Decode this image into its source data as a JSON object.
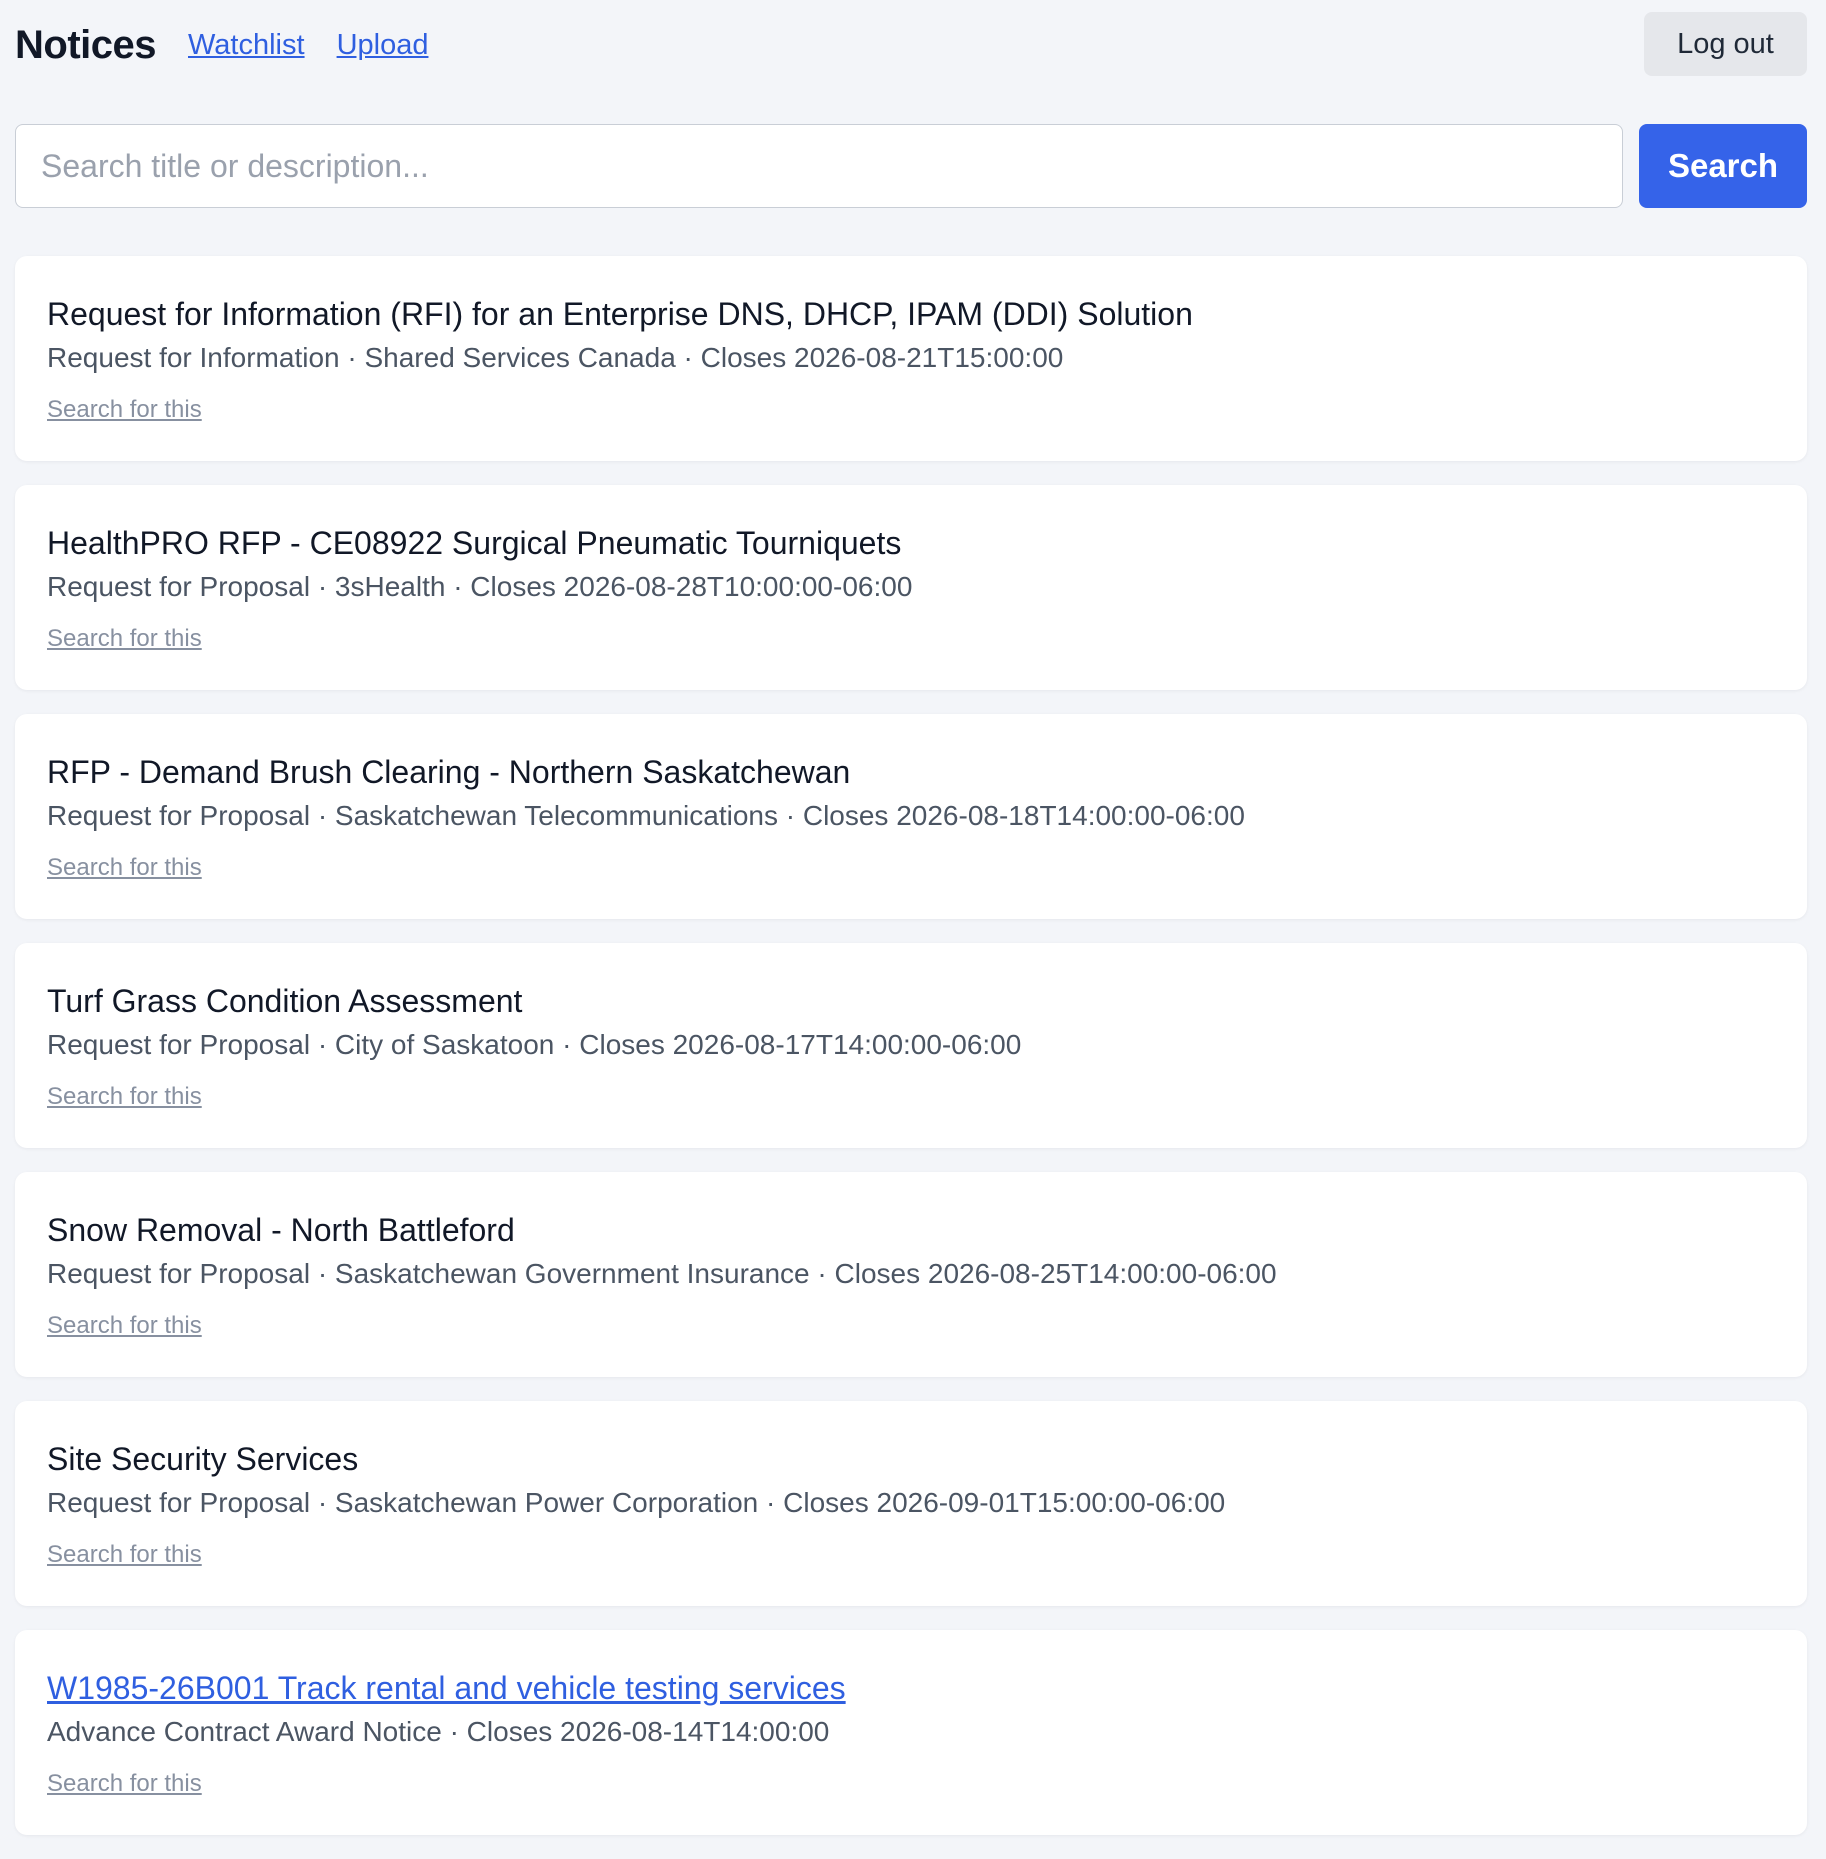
{
  "header": {
    "title": "Notices",
    "nav": [
      {
        "label": "Watchlist"
      },
      {
        "label": "Upload"
      }
    ],
    "logout_label": "Log out"
  },
  "search": {
    "placeholder": "Search title or description...",
    "value": "",
    "button_label": "Search"
  },
  "notices": [
    {
      "title": "Request for Information (RFI) for an Enterprise DNS, DHCP, IPAM (DDI) Solution",
      "meta": "Request for Information · Shared Services Canada · Closes 2026-08-21T15:00:00",
      "action_label": "Search for this",
      "title_is_link": false
    },
    {
      "title": "HealthPRO RFP - CE08922 Surgical Pneumatic Tourniquets",
      "meta": "Request for Proposal · 3sHealth · Closes 2026-08-28T10:00:00-06:00",
      "action_label": "Search for this",
      "title_is_link": false
    },
    {
      "title": "RFP - Demand Brush Clearing - Northern Saskatchewan",
      "meta": "Request for Proposal · Saskatchewan Telecommunications · Closes 2026-08-18T14:00:00-06:00",
      "action_label": "Search for this",
      "title_is_link": false
    },
    {
      "title": "Turf Grass Condition Assessment",
      "meta": "Request for Proposal · City of Saskatoon · Closes 2026-08-17T14:00:00-06:00",
      "action_label": "Search for this",
      "title_is_link": false
    },
    {
      "title": "Snow Removal - North Battleford",
      "meta": "Request for Proposal · Saskatchewan Government Insurance · Closes 2026-08-25T14:00:00-06:00",
      "action_label": "Search for this",
      "title_is_link": false
    },
    {
      "title": "Site Security Services",
      "meta": "Request for Proposal · Saskatchewan Power Corporation · Closes 2026-09-01T15:00:00-06:00",
      "action_label": "Search for this",
      "title_is_link": false
    },
    {
      "title": "W1985-26B001 Track rental and vehicle testing services",
      "meta": "Advance Contract Award Notice · Closes 2026-08-14T14:00:00",
      "action_label": "Search for this",
      "title_is_link": true
    }
  ],
  "colors": {
    "background": "#f3f5f9",
    "accent": "#3563e9",
    "link": "#2f5fe0",
    "card": "#ffffff",
    "muted_link": "#8790a0"
  }
}
